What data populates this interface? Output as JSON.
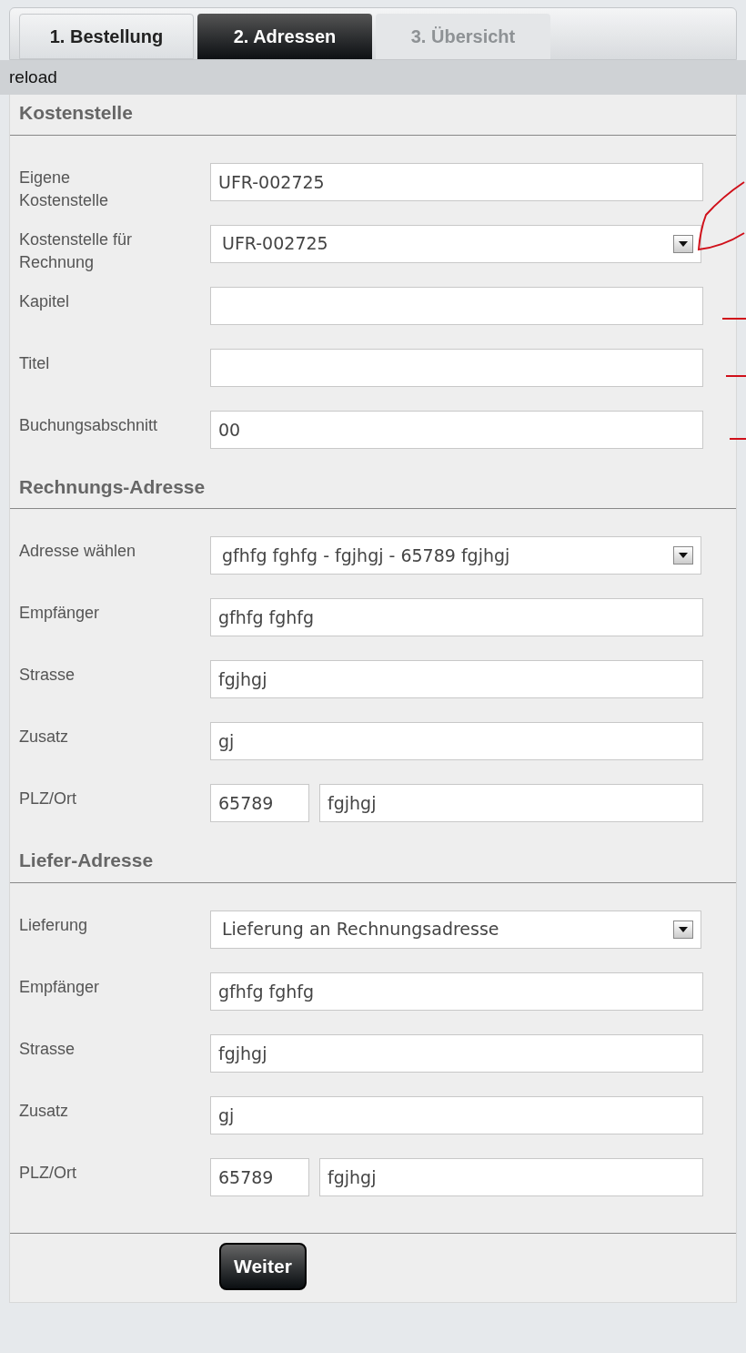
{
  "tabs": [
    {
      "label": "1. Bestellung",
      "selected": false,
      "disabled": false
    },
    {
      "label": "2. Adressen",
      "selected": true,
      "disabled": false
    },
    {
      "label": "3. Übersicht",
      "selected": false,
      "disabled": true
    }
  ],
  "toolbar": {
    "link": "reload"
  },
  "sections": [
    {
      "title": "Kostenstelle",
      "rows": [
        {
          "label": "Eigene Kostenstelle",
          "kind": "text",
          "value": "UFR-002725"
        },
        {
          "label": "Kostenstelle für Rechnung",
          "kind": "select",
          "value": "UFR-002725"
        },
        {
          "label": "Kapitel",
          "kind": "text"
        },
        {
          "label": "Titel",
          "kind": "text"
        },
        {
          "label": "Buchungsabschnitt",
          "kind": "text",
          "value": "00"
        }
      ]
    },
    {
      "title": "Rechnungs-Adresse",
      "rows": [
        {
          "label": "Adresse wählen",
          "kind": "select",
          "value": "gfhfg fghfg - fgjhgj - 65789 fgjhgj"
        },
        {
          "label": "Empfänger",
          "kind": "text",
          "value": "gfhfg fghfg"
        },
        {
          "label": "Strasse",
          "kind": "text",
          "value": "fgjhgj"
        },
        {
          "label": "Zusatz",
          "kind": "text",
          "value": "gj"
        },
        {
          "label": "PLZ/Ort",
          "kind": "split",
          "value": "65789",
          "value_2": "fgjhgj"
        }
      ]
    },
    {
      "title": "Liefer-Adresse",
      "rows": [
        {
          "label": "Lieferung",
          "kind": "select",
          "value": "Lieferung an Rechnungsadresse"
        },
        {
          "label": "Empfänger",
          "kind": "text",
          "value": "gfhfg fghfg"
        },
        {
          "label": "Strasse",
          "kind": "text",
          "value": "fgjhgj"
        },
        {
          "label": "Zusatz",
          "kind": "text",
          "value": "gj"
        },
        {
          "label": "PLZ/Ort",
          "kind": "split",
          "value": "65789",
          "value_2": "fgjhgj"
        }
      ]
    }
  ],
  "submit": "Weiter"
}
